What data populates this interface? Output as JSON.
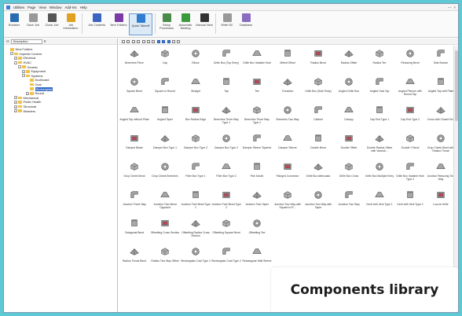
{
  "menubar": {
    "items": [
      "Utilities",
      "Page",
      "View",
      "Window",
      "Add-Ins",
      "Help"
    ]
  },
  "ribbon": {
    "buttons": [
      {
        "label": "Browser",
        "icon": "browser-icon",
        "color": "#2b6cb0"
      },
      {
        "label": "Save Job",
        "icon": "save-icon",
        "color": "#999999"
      },
      {
        "label": "Close Job",
        "icon": "close-job-icon",
        "color": "#555555"
      },
      {
        "label": "Job Information",
        "icon": "info-icon",
        "color": "#e0a020"
      },
      {
        "label": "Job Contents",
        "icon": "contents-icon",
        "color": "#3a63c2"
      },
      {
        "label": "Item Folders",
        "icon": "folders-icon",
        "color": "#7a3ba6"
      },
      {
        "label": "Quick Takeoff",
        "icon": "takeoff-icon",
        "color": "#2f7dd1",
        "selected": true
      },
      {
        "label": "Setup Processes",
        "icon": "setup-icon",
        "color": "#4a8a4a"
      },
      {
        "label": "Automatic Nesting",
        "icon": "nesting-icon",
        "color": "#3b9a3b"
      },
      {
        "label": "Manual Nest",
        "icon": "manual-nest-icon",
        "color": "#333333"
      },
      {
        "label": "Write NC",
        "icon": "write-nc-icon",
        "color": "#999999"
      },
      {
        "label": "Database",
        "icon": "database-icon",
        "color": "#8a6cc0"
      }
    ]
  },
  "leftpane": {
    "filter_label": "Description",
    "tree": [
      {
        "label": "New Folders",
        "indent": 0,
        "exp": ""
      },
      {
        "label": "Imperial Content",
        "indent": 1,
        "exp": "-"
      },
      {
        "label": "Electrical",
        "indent": 2,
        "exp": "+"
      },
      {
        "label": "HVAC",
        "indent": 2,
        "exp": "-"
      },
      {
        "label": "Generic",
        "indent": 3,
        "exp": "-"
      },
      {
        "label": "Equipment",
        "indent": 4,
        "exp": "+"
      },
      {
        "label": "Systems",
        "indent": 4,
        "exp": "-"
      },
      {
        "label": "Ductboard",
        "indent": 5,
        "exp": ""
      },
      {
        "label": "Oval",
        "indent": 5,
        "exp": ""
      },
      {
        "label": "Rectangular",
        "indent": 5,
        "exp": "",
        "selected": true
      },
      {
        "label": "Round",
        "indent": 5,
        "exp": "+"
      },
      {
        "label": "Mechanical",
        "indent": 2,
        "exp": "+"
      },
      {
        "label": "Public Health",
        "indent": 2,
        "exp": "+"
      },
      {
        "label": "Structural",
        "indent": 2,
        "exp": "+"
      },
      {
        "label": "Weaders",
        "indent": 2,
        "exp": "+"
      }
    ]
  },
  "items": [
    "Breeches Piece",
    "Cap",
    "Elbow",
    "Grille Box (Top Entry)",
    "Grille Box Variable Hole",
    "Mitred Offset",
    "Radius Bend",
    "Radius Offset",
    "Radius Tee",
    "Reducing Bend",
    "Side Branch",
    "Square Bend",
    "Square to Round",
    "Straight",
    "Tap",
    "Tee",
    "Transition",
    "Grille Box (Side Entry)",
    "Angled Grille Box",
    "Angled Oval Tap",
    "Angled Plenum with Round Tap",
    "Angled Tap with Plate",
    "Angled Tap without Plate",
    "Angled Taper",
    "Box Radius Edge",
    "Breeches Three Way Type 1",
    "Breeches Three Way Type 2",
    "Breeches Two Way",
    "Cabinet",
    "Canopy",
    "Cap End Type 1",
    "Cap End Type 2",
    "Cross with Closed End",
    "Damper Blade",
    "Damper Box Type 1",
    "Damper Box Type 2",
    "Damper Box Type 2",
    "Damper Sleeve Tapered",
    "Damper Sleeve",
    "Double Bend",
    "Double Offset",
    "Double Radius Offset with Vanes&...",
    "Double Y Bend",
    "Drop Cheek Bend with Radius Throat",
    "Drop Cheek Bend",
    "Drop Cheek Breeches",
    "Filter Box Type 1",
    "Filter Box Type 2",
    "Fish Mouth",
    "Flanged Connector",
    "Grille Box Attenuator",
    "Grille Box Cross",
    "Grille Box Multiple Entry",
    "Grille Box Variable Hole Type 2",
    "Junction Reducing Two Way",
    "Junction Three Way",
    "Junction Twin Bend Opposed",
    "Junction Twin Bend Type 1",
    "Junction Twin Bend Type 2",
    "Junction Twin Taper",
    "Junction Two Way with Square to R...",
    "Junction Two Way with Taper",
    "Junction Two Way",
    "Kerb with Vent Type 1",
    "Kerb with Vent Type 2",
    "Louvre Grille",
    "Octagonal Bend",
    "Offsetting Cross Section",
    "Offsetting Radius Cross Section",
    "Offsetting Square Bend",
    "Offsetting Tee",
    "",
    "",
    "",
    "",
    "",
    "",
    "Radius Throat Bend",
    "Radius Two Way Offset",
    "Rectangular Cowl Type 1",
    "Rectangular Cowl Type 2",
    "Rectangular Wall Sleeve"
  ],
  "overlay": {
    "text": "Components library"
  }
}
